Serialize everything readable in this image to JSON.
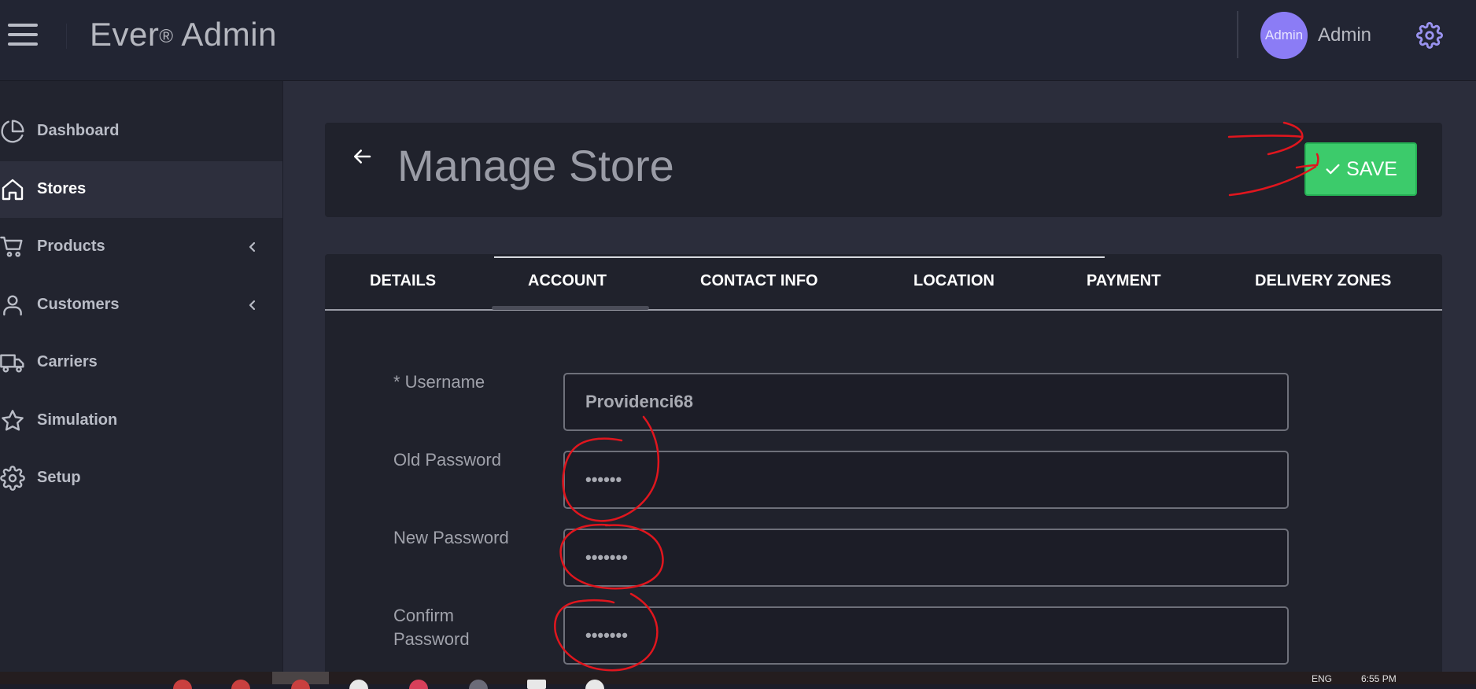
{
  "header": {
    "brand_name": "Ever",
    "brand_reg": "®",
    "brand_suffix": " Admin",
    "avatar_text": "Admin",
    "user_name": "Admin"
  },
  "sidebar": {
    "items": [
      {
        "label": "Dashboard",
        "icon": "pie-chart-icon"
      },
      {
        "label": "Stores",
        "icon": "home-icon",
        "active": true
      },
      {
        "label": "Products",
        "icon": "cart-icon",
        "has_submenu": true
      },
      {
        "label": "Customers",
        "icon": "user-icon",
        "has_submenu": true
      },
      {
        "label": "Carriers",
        "icon": "truck-icon"
      },
      {
        "label": "Simulation",
        "icon": "star-icon"
      },
      {
        "label": "Setup",
        "icon": "gear-icon"
      }
    ]
  },
  "page": {
    "title": "Manage Store",
    "save_label": "SAVE"
  },
  "tabs": [
    {
      "label": "DETAILS"
    },
    {
      "label": "ACCOUNT",
      "active": true
    },
    {
      "label": "CONTACT INFO"
    },
    {
      "label": "LOCATION"
    },
    {
      "label": "PAYMENT"
    },
    {
      "label": "DELIVERY ZONES"
    }
  ],
  "form": {
    "username_label": "* Username",
    "username_value": "Providenci68",
    "old_password_label": "Old Password",
    "old_password_value": "••••••",
    "new_password_label": "New Password",
    "new_password_value": "•••••••",
    "confirm_password_label_1": "Confirm",
    "confirm_password_label_2": "Password",
    "confirm_password_value": "•••••••"
  },
  "taskbar": {
    "language": "ENG",
    "clock": "6:55 PM"
  },
  "colors": {
    "save_green": "#3ccb6b",
    "annotation_red": "#e0161e",
    "avatar_purple": "#8b7cf5"
  }
}
